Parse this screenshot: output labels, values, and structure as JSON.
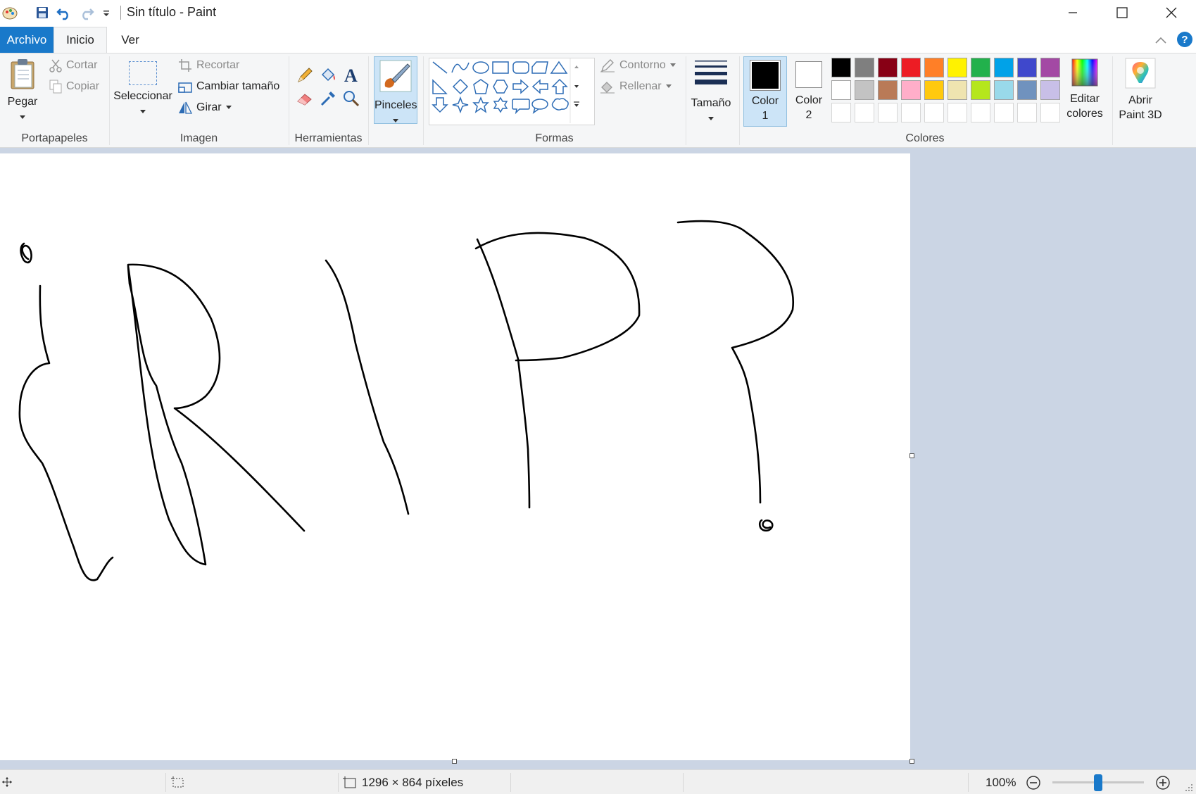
{
  "window": {
    "title": "Sin título - Paint"
  },
  "tabs": {
    "archivo": "Archivo",
    "inicio": "Inicio",
    "ver": "Ver"
  },
  "ribbon": {
    "portapapeles": {
      "pegar": "Pegar",
      "cortar": "Cortar",
      "copiar": "Copiar",
      "group_label": "Portapapeles"
    },
    "imagen": {
      "seleccionar": "Seleccionar",
      "recortar": "Recortar",
      "cambiar_tamano": "Cambiar tamaño",
      "girar": "Girar",
      "group_label": "Imagen"
    },
    "herramientas": {
      "group_label": "Herramientas",
      "tools": [
        "pencil-icon",
        "fill-bucket-icon",
        "text-icon",
        "eraser-icon",
        "color-picker-icon",
        "magnifier-icon"
      ]
    },
    "pinceles": {
      "label": "Pinceles"
    },
    "formas": {
      "contorno": "Contorno",
      "rellenar": "Rellenar",
      "group_label": "Formas",
      "shapes": [
        "line",
        "curve",
        "oval",
        "rectangle",
        "rounded-rectangle",
        "polygon",
        "triangle",
        "right-triangle",
        "diamond",
        "pentagon",
        "hexagon",
        "right-arrow",
        "left-arrow",
        "up-arrow",
        "down-arrow",
        "four-point-star",
        "five-point-star",
        "six-point-star",
        "rounded-callout",
        "oval-callout",
        "cloud-callout"
      ]
    },
    "tamano": {
      "label": "Tamaño"
    },
    "colores": {
      "color1_line1": "Color",
      "color1_line2": "1",
      "color2_line1": "Color",
      "color2_line2": "2",
      "color1_value": "#000000",
      "color2_value": "#ffffff",
      "editar_line1": "Editar",
      "editar_line2": "colores",
      "group_label": "Colores",
      "palette_row1": [
        "#000000",
        "#7f7f7f",
        "#880015",
        "#ed1c24",
        "#ff7f27",
        "#fff200",
        "#22b14c",
        "#00a2e8",
        "#3f48cc",
        "#a349a4"
      ],
      "palette_row2": [
        "#ffffff",
        "#c3c3c3",
        "#b97a57",
        "#ffaec9",
        "#ffc90e",
        "#efe4b0",
        "#b5e61d",
        "#99d9ea",
        "#7092be",
        "#c8bfe7"
      ]
    },
    "paint3d": {
      "line1": "Abrir",
      "line2": "Paint 3D"
    }
  },
  "status": {
    "dimensions": "1296 × 864 píxeles",
    "zoom": "100%",
    "zoom_level": 1.0
  }
}
